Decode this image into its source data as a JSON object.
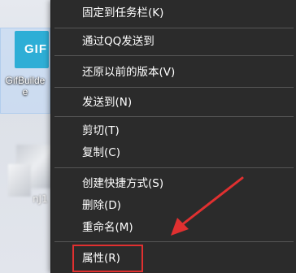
{
  "desktop": {
    "selected_icon_tile_text": "GIF",
    "selected_icon_caption_line1": "GifBuilde",
    "selected_icon_caption_line2": "e",
    "blurred_icon_caption": "nJ1",
    "gif_tile_color": "#2eaed6"
  },
  "context_menu": {
    "items": [
      {
        "label": "固定到任务栏(K)"
      },
      {
        "label": "通过QQ发送到"
      },
      {
        "label": "还原以前的版本(V)"
      },
      {
        "label": "发送到(N)"
      },
      {
        "label": "剪切(T)"
      },
      {
        "label": "复制(C)"
      },
      {
        "label": "创建快捷方式(S)"
      },
      {
        "label": "删除(D)"
      },
      {
        "label": "重命名(M)"
      },
      {
        "label": "属性(R)"
      }
    ],
    "background_color": "#2b2b2b"
  },
  "annotation": {
    "highlight_color": "#e03030",
    "highlighted_item": "属性(R)"
  }
}
